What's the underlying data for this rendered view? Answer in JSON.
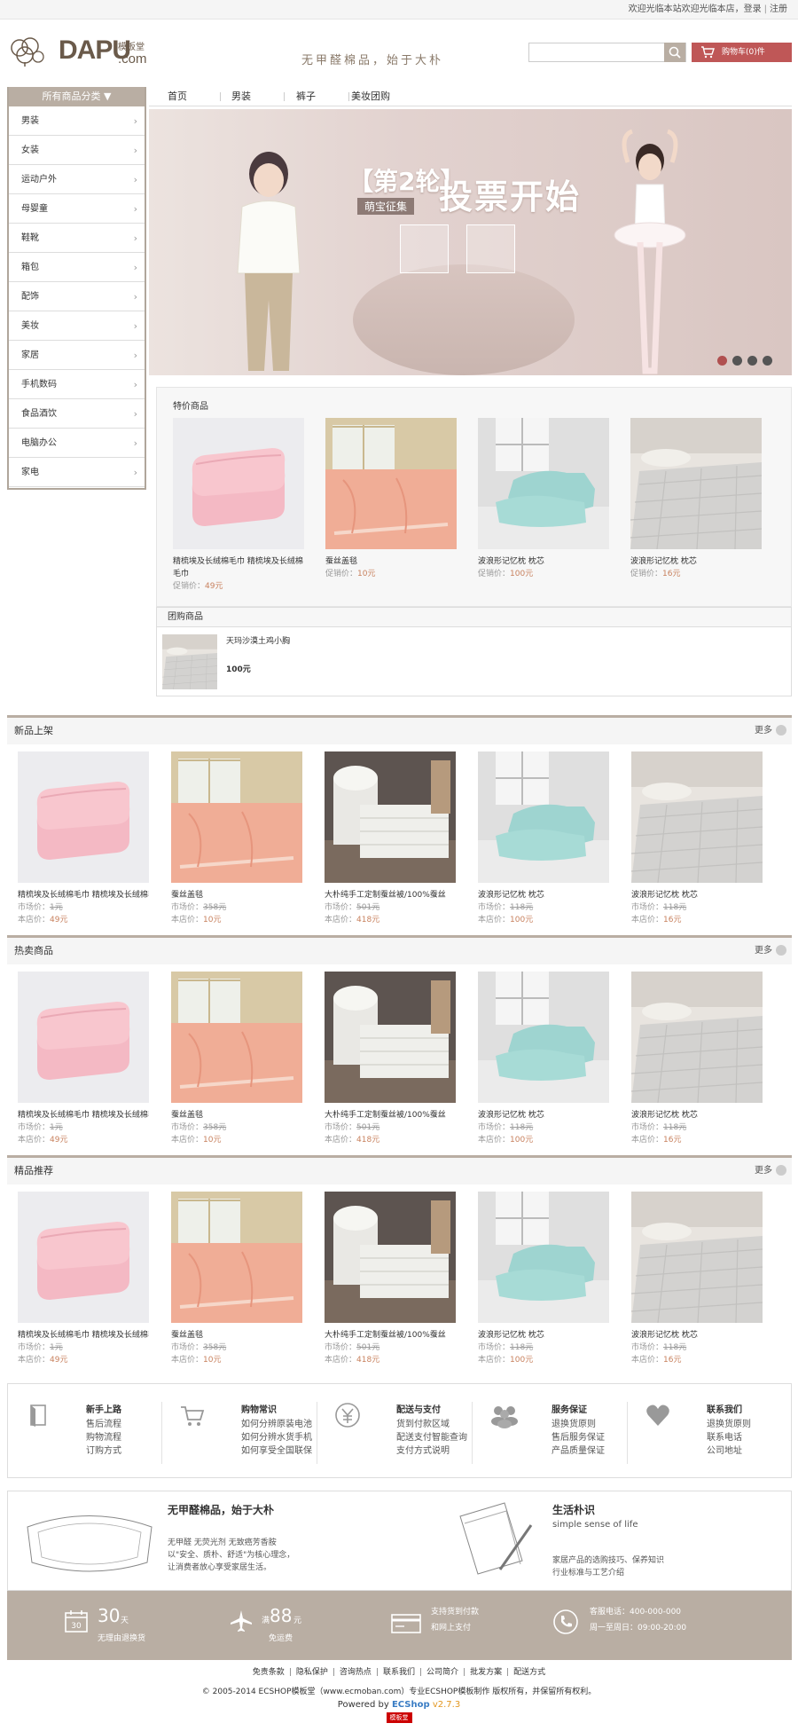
{
  "topbar": {
    "welcome": "欢迎光临本站欢迎光临本店，",
    "login": "登录",
    "register": "注册"
  },
  "header": {
    "brand": "DAPU",
    "brand_cn": "模板堂",
    "brand_com": ".com",
    "slogan": "无甲醛棉品，始于大朴",
    "search_placeholder": "",
    "cart": "购物车(0)件"
  },
  "sidebar": {
    "head": "所有商品分类",
    "items": [
      "男装",
      "女装",
      "运动户外",
      "母婴童",
      "鞋靴",
      "箱包",
      "配饰",
      "美妆",
      "家居",
      "手机数码",
      "食品酒饮",
      "电脑办公",
      "家电"
    ]
  },
  "nav": [
    "首页",
    "男装",
    "裤子",
    "美妆团购"
  ],
  "banner": {
    "round": "【第2轮】",
    "sub": "萌宝征集",
    "title": "投票开始",
    "slides": 4,
    "active_slide": 1
  },
  "special": {
    "title": "特价商品",
    "price_label": "促销价：",
    "items": [
      {
        "name": "精梳埃及长绒棉毛巾 精梳埃及长绒棉毛巾",
        "price": "49元",
        "img": "towel"
      },
      {
        "name": "蚕丝盖毯",
        "price": "10元",
        "img": "blanket"
      },
      {
        "name": "波浪形记忆枕 枕芯",
        "price": "100元",
        "img": "pillow"
      },
      {
        "name": "波浪形记忆枕 枕芯",
        "price": "16元",
        "img": "bed"
      }
    ]
  },
  "group": {
    "title": "团购商品",
    "name": "天玛沙漠土鸡小胸",
    "price": "100元"
  },
  "labels": {
    "market": "市场价：",
    "shop": "本店价：",
    "more": "更多"
  },
  "sections": [
    {
      "title": "新品上架"
    },
    {
      "title": "热卖商品"
    },
    {
      "title": "精品推荐"
    }
  ],
  "products": [
    {
      "name": "精梳埃及长绒棉毛巾 精梳埃及长绒棉毛巾",
      "market": "1元",
      "shop": "49元",
      "img": "towel"
    },
    {
      "name": "蚕丝盖毯",
      "market": "358元",
      "shop": "10元",
      "img": "blanket"
    },
    {
      "name": "大朴纯手工定制蚕丝被/100%蚕丝",
      "market": "501元",
      "shop": "418元",
      "img": "quilt"
    },
    {
      "name": "波浪形记忆枕 枕芯",
      "market": "118元",
      "shop": "100元",
      "img": "pillow"
    },
    {
      "name": "波浪形记忆枕 枕芯",
      "market": "118元",
      "shop": "16元",
      "img": "bed"
    }
  ],
  "help": [
    {
      "title": "新手上路",
      "links": [
        "售后流程",
        "购物流程",
        "订购方式"
      ],
      "icon": "book-icon"
    },
    {
      "title": "购物常识",
      "links": [
        "如何分辨原装电池",
        "如何分辨水货手机",
        "如何享受全国联保"
      ],
      "icon": "cart-icon"
    },
    {
      "title": "配送与支付",
      "links": [
        "货到付款区域",
        "配送支付智能查询",
        "支付方式说明"
      ],
      "icon": "yen-icon"
    },
    {
      "title": "服务保证",
      "links": [
        "退换货原则",
        "售后服务保证",
        "产品质量保证"
      ],
      "icon": "people-icon"
    },
    {
      "title": "联系我们",
      "links": [
        "退换货原则",
        "联系电话",
        "公司地址"
      ],
      "icon": "heart-icon"
    }
  ],
  "about": {
    "title": "无甲醛棉品，始于大朴",
    "lines": [
      "无甲醛 无荧光剂 无致癌芳香胺",
      "以\"安全、质朴、舒适\"为核心理念，",
      "让消费者放心享受家居生活。"
    ],
    "title2": "生活朴识",
    "sub2": "simple sense of life",
    "lines2": [
      "家居产品的选购技巧、保养知识",
      "行业标准与工艺介绍"
    ]
  },
  "service": {
    "days_num": "30",
    "days_unit": "天",
    "days_txt": "无理由退换货",
    "ship_pre": "满",
    "ship_num": "88",
    "ship_unit": "元",
    "ship_txt": "免运费",
    "pay1": "支持货到付款",
    "pay2": "和网上支付",
    "tel": "客服电话：400-000-000",
    "hours": "周一至周日：09:00-20:00"
  },
  "footer": {
    "links": [
      "免责条款",
      "隐私保护",
      "咨询热点",
      "联系我们",
      "公司简介",
      "批发方案",
      "配送方式"
    ],
    "copyright": "© 2005-2014 ECSHOP模板堂（www.ecmoban.com）专业ECSHOP模板制作 版权所有，并保留所有权利。",
    "powered": "Powered by",
    "ecshop": "ECShop",
    "version": "v2.7.3",
    "badge": "模板堂"
  },
  "colors": {
    "accent": "#b9aea3",
    "cart": "#bf5757",
    "price": "#c8815e"
  }
}
